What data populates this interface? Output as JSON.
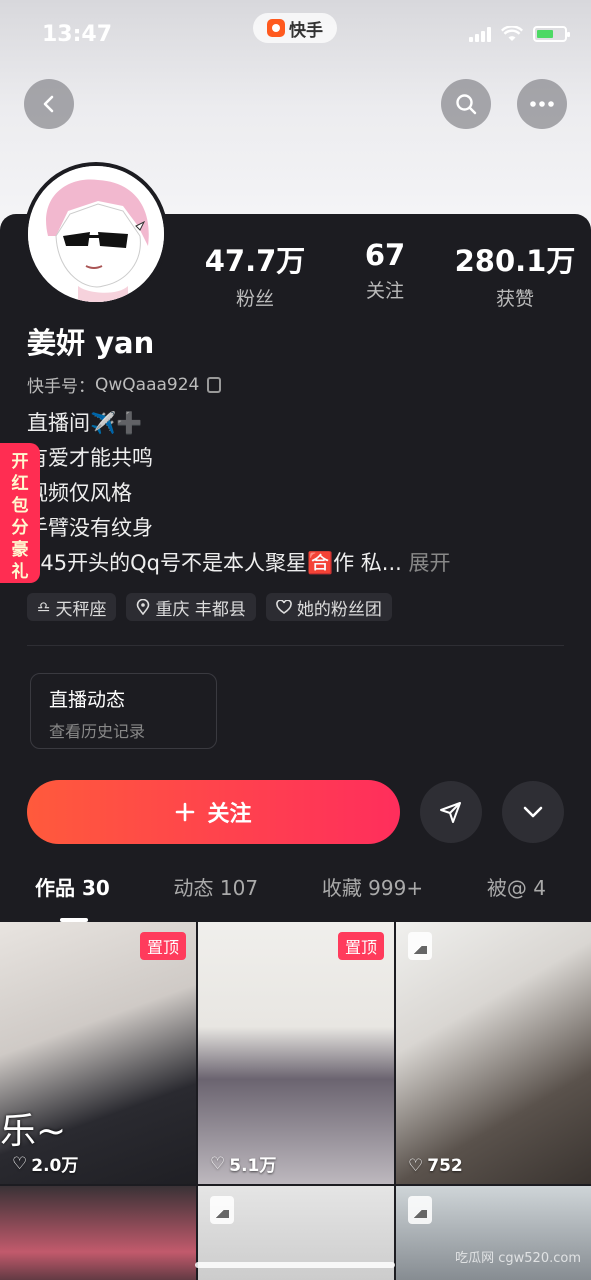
{
  "status_bar": {
    "time": "13:47",
    "app_name": "快手"
  },
  "header": {
    "back_icon": "chevron-left-icon",
    "search_icon": "search-icon",
    "more_icon": "more-horizontal-icon"
  },
  "profile": {
    "name": "姜妍 yan",
    "uid_label": "快手号：",
    "uid": "QwQaaa924",
    "stats": [
      {
        "value": "47.7万",
        "label": "粉丝"
      },
      {
        "value": "67",
        "label": "关注"
      },
      {
        "value": "280.1万",
        "label": "获赞"
      }
    ],
    "bio_lines": [
      "直播间✈️➕",
      "有爱才能共鸣",
      "视频仅风格",
      "手臂没有纹身",
      "245开头的Qq号不是本人聚星🈴作 私... "
    ],
    "bio_more": "展开",
    "tags": [
      {
        "icon": "libra-icon",
        "text": "天秤座"
      },
      {
        "icon": "location-icon",
        "text": "重庆 丰都县"
      },
      {
        "icon": "heart-shield-icon",
        "text": "她的粉丝团"
      }
    ]
  },
  "hongbao": {
    "chars": [
      "开",
      "红",
      "包",
      "分",
      "豪",
      "礼"
    ]
  },
  "live_card": {
    "title": "直播动态",
    "subtitle": "查看历史记录"
  },
  "actions": {
    "follow_label": "关注",
    "share_icon": "send-icon",
    "expand_icon": "chevron-down-icon"
  },
  "tabs": [
    {
      "label": "作品 30",
      "active": true
    },
    {
      "label": "动态 107",
      "active": false
    },
    {
      "label": "收藏 999+",
      "active": false
    },
    {
      "label": "被@ 4",
      "active": false
    }
  ],
  "works": [
    {
      "pinned": "置顶",
      "likes": "2.0万",
      "overlay": "乐~"
    },
    {
      "pinned": "置顶",
      "likes": "5.1万"
    },
    {
      "likes": "752"
    }
  ],
  "watermark": "吃瓜网 cgw520.com"
}
